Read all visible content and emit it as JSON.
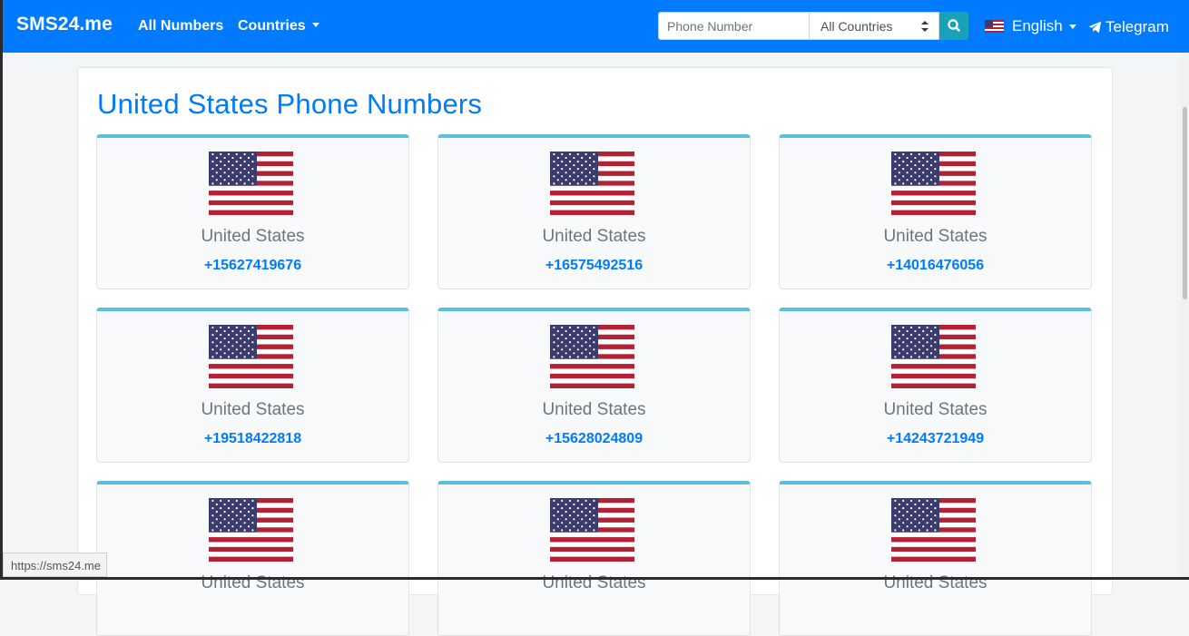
{
  "navbar": {
    "brand": "SMS24.me",
    "links": {
      "all_numbers": "All Numbers",
      "countries": "Countries"
    },
    "search": {
      "placeholder": "Phone Number",
      "country_select_value": "All Countries",
      "button_icon": "search-icon"
    },
    "language": "English",
    "telegram": "Telegram",
    "bg_color": "#007bff"
  },
  "page": {
    "title": "United States Phone Numbers"
  },
  "cards": [
    {
      "country": "United States",
      "phone": "+15627419676"
    },
    {
      "country": "United States",
      "phone": "+16575492516"
    },
    {
      "country": "United States",
      "phone": "+14016476056"
    },
    {
      "country": "United States",
      "phone": "+19518422818"
    },
    {
      "country": "United States",
      "phone": "+15628024809"
    },
    {
      "country": "United States",
      "phone": "+14243721949"
    },
    {
      "country": "United States",
      "phone": ""
    },
    {
      "country": "United States",
      "phone": ""
    },
    {
      "country": "United States",
      "phone": ""
    }
  ],
  "status_bar": {
    "url": "https://sms24.me"
  },
  "colors": {
    "accent": "#007bff",
    "card_top": "#5bc0de",
    "search_button": "#17a2b8"
  }
}
